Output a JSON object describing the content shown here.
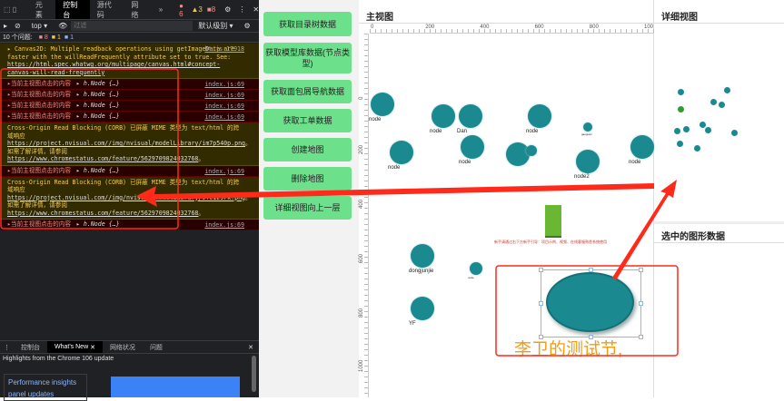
{
  "devtools": {
    "tabs": [
      "元素",
      "控制台",
      "源代码",
      "网络"
    ],
    "more": "»",
    "badges": {
      "errors": "6",
      "warnings": "3",
      "issues": "8"
    },
    "context": "top ▾",
    "filter_placeholder": "过滤",
    "level": "默认级别 ▾",
    "issues_bar": {
      "label": "10 个问题:",
      "err": "8",
      "warn": "1",
      "info": "1"
    },
    "canvas_warning": {
      "text": "Canvas2D: Multiple readback operations using getImageData are faster with the willReadFrequently attribute set to true. See: ",
      "link": "https://html.spec.whatwg.org/multipage/canvas.html#concept-canvas-will-read-frequently",
      "src": "ht.js:17918"
    },
    "log_text": "当前主视图点击的内容",
    "log_obj": "h.Node {…}",
    "log_src": "index.js:69",
    "corb1": {
      "pre": "Cross-Origin Read Blocking (CORB) 已屏蔽 MIME 类型为 text/html 的跨域响应 ",
      "link1": "https://project.nvisual.com//img/nvisual/modelLibrary/im7p540p.png",
      "mid": "。如需了解详情，请参阅 ",
      "link2": "https://www.chromestatus.com/feature/5629709824032768",
      "end": "。"
    },
    "corb2": {
      "pre": "Cross-Origin Read Blocking (CORB) 已屏蔽 MIME 类型为 text/html 的跨域响应 ",
      "link1": "https://project.nvisual.com//img/nvisual/modelLibrary/9fc1z9rk.png",
      "mid": "。如需了解详情，请参阅 ",
      "link2": "https://www.chromestatus.com/feature/5629709824032768",
      "end": "。"
    },
    "drawer_tabs": [
      "控制台",
      "What's New",
      "网络状况",
      "问题"
    ],
    "whatsnew_header": "Highlights from the Chrome 106 update",
    "whatsnew_item": "Performance insights panel updates"
  },
  "buttons": [
    "获取目录树数据",
    "获取模型库数据(节点类型)",
    "获取面包屑导航数据",
    "获取工单数据",
    "创建地图",
    "删除地图",
    "详细视图向上一层"
  ],
  "main": {
    "title": "主视图",
    "x_ticks": [
      "0",
      "200",
      "400",
      "600",
      "800",
      "100"
    ],
    "y_ticks": [
      "0",
      "200",
      "400",
      "600",
      "800",
      "1000"
    ],
    "nodes": [
      "node",
      "node",
      "Dan",
      "node",
      "gaoguan",
      "node",
      "node",
      "node2",
      "node",
      "dongjunjie",
      "node",
      "YF"
    ],
    "hint": "新手请通过右下方新手引导：项目示例、视频、在线客服熟悉系统使用",
    "selected_label": "李卫的测试节,"
  },
  "detail": {
    "title": "详细视图",
    "selected_title": "选中的图形数据"
  },
  "colors": {
    "node": "#1a8a90",
    "button": "#6ce08a",
    "annotation": "#ff2a1a"
  }
}
